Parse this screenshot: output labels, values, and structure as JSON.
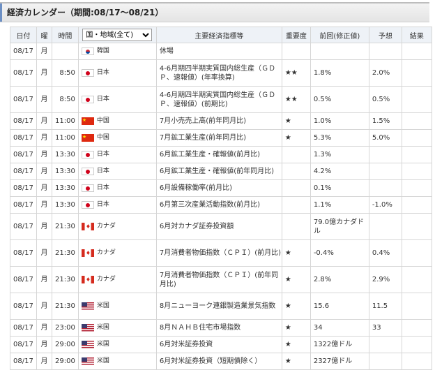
{
  "header": {
    "title": "経済カレンダー（期間:08/17〜08/21）"
  },
  "columns": {
    "date": "日付",
    "weekday": "曜",
    "time": "時間",
    "country_select": "国・地域(全て)",
    "indicator": "主要経済指標等",
    "importance": "重要度",
    "previous": "前回(修正値)",
    "forecast": "予想",
    "result": "結果"
  },
  "rows": [
    {
      "date": "08/17",
      "weekday": "月",
      "time": "",
      "flag": "kr",
      "country": "韓国",
      "indicator": "休場",
      "importance": "",
      "previous": "",
      "forecast": "",
      "result": ""
    },
    {
      "date": "08/17",
      "weekday": "月",
      "time": "8:50",
      "flag": "jp",
      "country": "日本",
      "indicator": "4-6月期四半期実質国内総生産（ＧＤＰ、速報値）(年率換算)",
      "importance": "★★",
      "previous": "1.8%",
      "forecast": "2.0%",
      "result": ""
    },
    {
      "date": "08/17",
      "weekday": "月",
      "time": "8:50",
      "flag": "jp",
      "country": "日本",
      "indicator": "4-6月期四半期実質国内総生産（ＧＤＰ、速報値）(前期比)",
      "importance": "★★",
      "previous": "0.5%",
      "forecast": "0.5%",
      "result": ""
    },
    {
      "date": "08/17",
      "weekday": "月",
      "time": "11:00",
      "flag": "cn",
      "country": "中国",
      "indicator": "7月小売売上高(前年同月比)",
      "importance": "★",
      "previous": "1.0%",
      "forecast": "1.5%",
      "result": ""
    },
    {
      "date": "08/17",
      "weekday": "月",
      "time": "11:00",
      "flag": "cn",
      "country": "中国",
      "indicator": "7月鉱工業生産(前年同月比)",
      "importance": "★",
      "previous": "5.3%",
      "forecast": "5.0%",
      "result": ""
    },
    {
      "date": "08/17",
      "weekday": "月",
      "time": "13:30",
      "flag": "jp",
      "country": "日本",
      "indicator": "6月鉱工業生産・確報値(前月比)",
      "importance": "",
      "previous": "1.3%",
      "forecast": "",
      "result": ""
    },
    {
      "date": "08/17",
      "weekday": "月",
      "time": "13:30",
      "flag": "jp",
      "country": "日本",
      "indicator": "6月鉱工業生産・確報値(前年同月比)",
      "importance": "",
      "previous": "4.2%",
      "forecast": "",
      "result": ""
    },
    {
      "date": "08/17",
      "weekday": "月",
      "time": "13:30",
      "flag": "jp",
      "country": "日本",
      "indicator": "6月設備稼働率(前月比)",
      "importance": "",
      "previous": "0.1%",
      "forecast": "",
      "result": ""
    },
    {
      "date": "08/17",
      "weekday": "月",
      "time": "13:30",
      "flag": "jp",
      "country": "日本",
      "indicator": "6月第三次産業活動指数(前月比)",
      "importance": "",
      "previous": "1.1%",
      "forecast": "-1.0%",
      "result": ""
    },
    {
      "date": "08/17",
      "weekday": "月",
      "time": "21:30",
      "flag": "ca",
      "country": "カナダ",
      "indicator": "6月対カナダ証券投資額",
      "importance": "",
      "previous": "79.0億カナダドル",
      "forecast": "",
      "result": ""
    },
    {
      "date": "08/17",
      "weekday": "月",
      "time": "21:30",
      "flag": "ca",
      "country": "カナダ",
      "indicator": "7月消費者物価指数（ＣＰＩ）(前月比)",
      "importance": "★",
      "previous": "-0.4%",
      "forecast": "0.4%",
      "result": ""
    },
    {
      "date": "08/17",
      "weekday": "月",
      "time": "21:30",
      "flag": "ca",
      "country": "カナダ",
      "indicator": "7月消費者物価指数（ＣＰＩ）(前年同月比)",
      "importance": "★",
      "previous": "2.8%",
      "forecast": "2.9%",
      "result": ""
    },
    {
      "date": "08/17",
      "weekday": "月",
      "time": "21:30",
      "flag": "us",
      "country": "米国",
      "indicator": "8月ニューヨーク連銀製造業景気指数",
      "importance": "★",
      "previous": "15.6",
      "forecast": "11.5",
      "result": ""
    },
    {
      "date": "08/17",
      "weekday": "月",
      "time": "23:00",
      "flag": "us",
      "country": "米国",
      "indicator": "8月ＮＡＨＢ住宅市場指数",
      "importance": "★",
      "previous": "34",
      "forecast": "33",
      "result": ""
    },
    {
      "date": "08/17",
      "weekday": "月",
      "time": "29:00",
      "flag": "us",
      "country": "米国",
      "indicator": "6月対米証券投資",
      "importance": "★",
      "previous": "1322億ドル",
      "forecast": "",
      "result": ""
    },
    {
      "date": "08/17",
      "weekday": "月",
      "time": "29:00",
      "flag": "us",
      "country": "米国",
      "indicator": "6月対米証券投資（短期債除く）",
      "importance": "★",
      "previous": "2327億ドル",
      "forecast": "",
      "result": ""
    }
  ],
  "tall_rows": [
    1,
    2,
    9,
    10,
    11,
    12
  ]
}
